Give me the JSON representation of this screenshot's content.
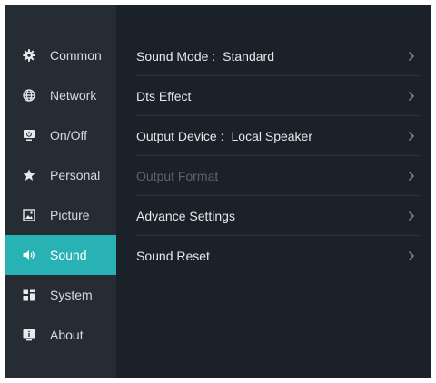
{
  "sidebar": {
    "items": [
      {
        "label": "Common",
        "icon": "gear-icon"
      },
      {
        "label": "Network",
        "icon": "globe-icon"
      },
      {
        "label": "On/Off",
        "icon": "power-monitor-icon"
      },
      {
        "label": "Personal",
        "icon": "star-icon"
      },
      {
        "label": "Picture",
        "icon": "picture-icon"
      },
      {
        "label": "Sound",
        "icon": "speaker-icon",
        "active": true
      },
      {
        "label": "System",
        "icon": "system-grid-icon"
      },
      {
        "label": "About",
        "icon": "info-monitor-icon"
      }
    ]
  },
  "sound": {
    "rows": [
      {
        "label": "Sound Mode :",
        "value": "Standard",
        "enabled": true
      },
      {
        "label": "Dts Effect",
        "value": "",
        "enabled": true
      },
      {
        "label": "Output Device :",
        "value": "Local Speaker",
        "enabled": true
      },
      {
        "label": "Output Format",
        "value": "",
        "enabled": false
      },
      {
        "label": "Advance Settings",
        "value": "",
        "enabled": true
      },
      {
        "label": "Sound Reset",
        "value": "",
        "enabled": true
      }
    ]
  },
  "colors": {
    "accent": "#29b2b4",
    "panel_bg": "#1b2129",
    "sidebar_bg": "#262c34",
    "disabled_text": "#5b636c"
  }
}
